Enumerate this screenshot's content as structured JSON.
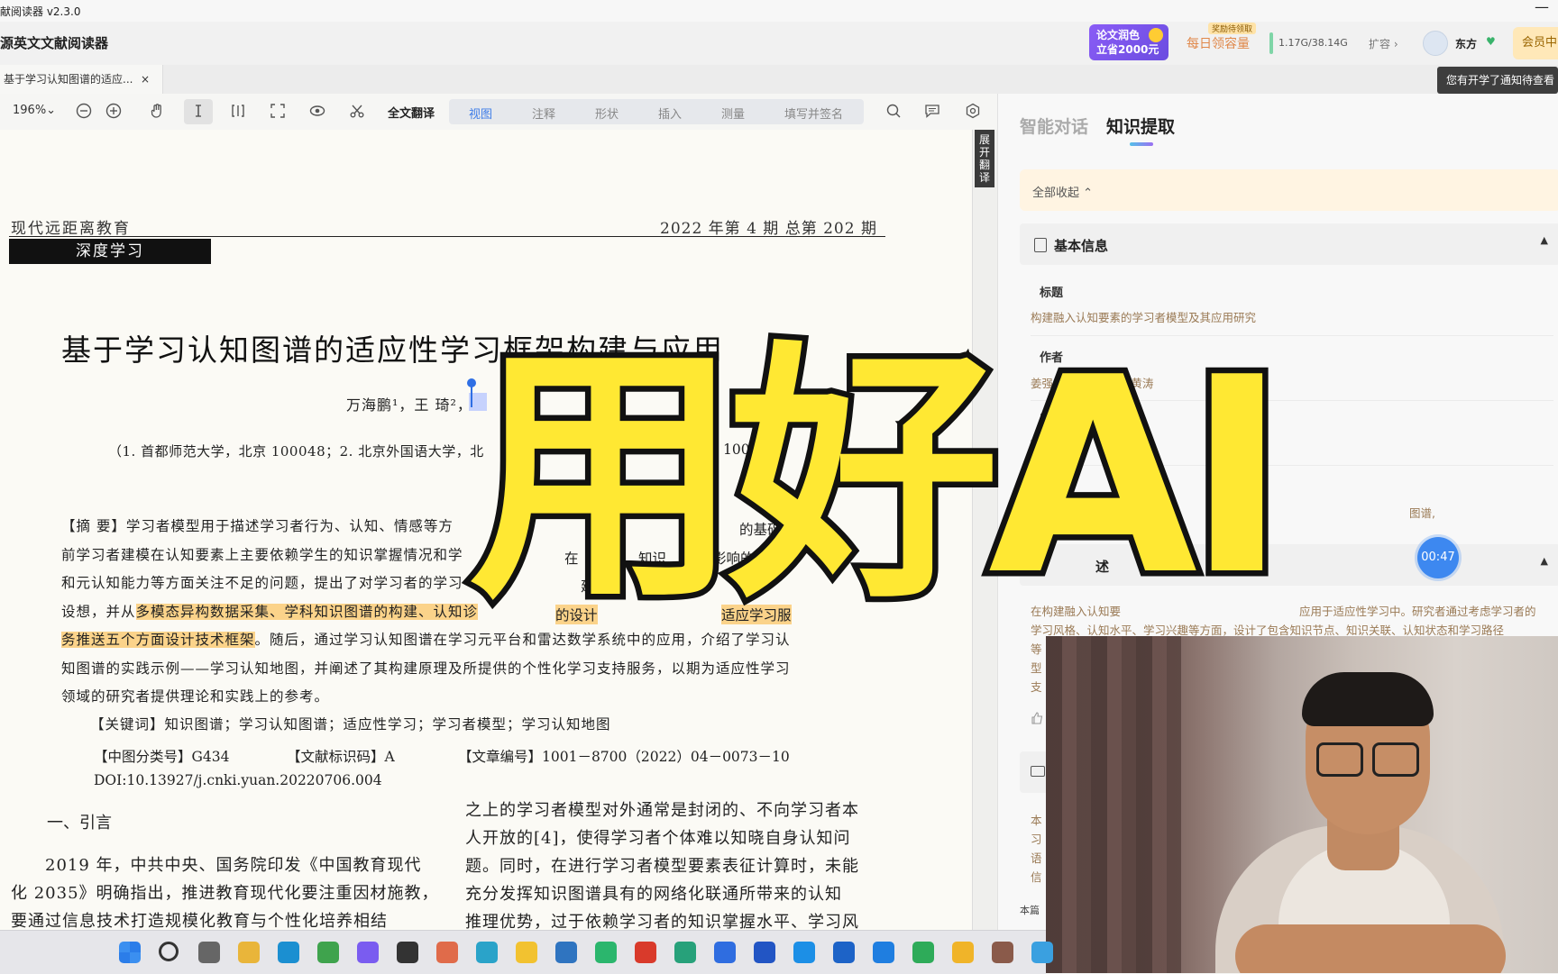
{
  "window": {
    "title": "献阅读器 v2.3.0",
    "minimize_glyph": "—"
  },
  "header": {
    "app_name": "源英文文献阅读器",
    "promo_line1": "论文润色",
    "promo_line2": "立省2000元",
    "daily_badge": "奖励待领取",
    "daily_label": "每日领容量",
    "storage": "1.17G/38.14G",
    "expand_label": "扩容 ›",
    "user_name": "东方",
    "user_vip": "♥",
    "member_label": "会员中"
  },
  "tabs": {
    "doc_tab_label": "基于学习认知图谱的适应...",
    "doc_tab_close": "×",
    "notify_text": "您有开学了通知待查看"
  },
  "toolbar": {
    "zoom": "196%⌄",
    "full_translate": "全文翻译",
    "tabs": [
      "视图",
      "注释",
      "形状",
      "插入",
      "测量",
      "填写并签名"
    ]
  },
  "document": {
    "journal_left": "现代远距离教育",
    "journal_right": "2022 年第 4 期   总第 202 期",
    "section_tag": "深度学习",
    "title": "基于学习认知图谱的适应性学习框架构建与应用",
    "authors": "万海鹏¹，王  琦²，",
    "affiliation": "（1. 首都师范大学，北京 100048；2. 北京外国语大学，北",
    "affiliation_tail": "100",
    "abstract_lines": [
      "【摘   要】学习者模型用于描述学习者行为、认知、情感等方",
      "前学习者建模在认知要素上主要依赖学生的知识掌握情况和学",
      "和元认知能力等方面关注不足的问题，提出了对学习者的学习",
      "设想，并从",
      "务推送五个方面设计技术框架",
      "知图谱的实践示例——学习认知地图，并阐述了其构建原理及所提供的个性化学习支持服务，以期为适应性学习",
      "领域的研究者提供理论和实践上的参考。"
    ],
    "abstract_right_fragments": [
      "的基础",
      "在",
      "知识",
      "影响的",
      "建模",
      "应用",
      "中",
      "适应学习服"
    ],
    "highlight_1": "多模态异构数据采集、学科知识图谱的构建、认知诊",
    "highlight_2": "的设计",
    "abstract_line5_rest": "。随后，通过学习认知图谱在学习元平台和雷达数学系统中的应用，介绍了学习认",
    "keywords": "【关键词】知识图谱；学习认知图谱；适应性学习；学习者模型；学习认知地图",
    "clc": "【中图分类号】G434",
    "doc_code": "【文献标识码】A",
    "article_no": "【文章编号】1001－8700（2022）04－0073－10",
    "doi": "DOI:10.13927/j.cnki.yuan.20220706.004",
    "intro_heading": "一、引言",
    "left_col": [
      "2019 年，中共中央、国务院印发《中国教育现代",
      "化 2035》明确指出，推进教育现代化要注重因材施教，",
      "要通过信息技术打造规模化教育与个性化培养相结"
    ],
    "right_col": [
      "之上的学习者模型对外通常是封闭的、不向学习者本",
      "人开放的[4]，使得学习者个体难以知晓自身认知问",
      "题。同时，在进行学习者模型要素表征计算时，未能",
      "充分发挥知识图谱具有的网络化联通所带来的认知",
      "推理优势，过于依赖学习者的知识掌握水平、学习风"
    ],
    "expand_translate": "展开翻译"
  },
  "panel": {
    "tab_chat": "智能对话",
    "tab_extract": "知识提取",
    "collapse_all": "全部收起 ⌃",
    "basic_info": "基本信息",
    "caret": "▲",
    "fields": [
      {
        "label": "标题",
        "value": "构建融入认知要素的学习者模型及其应用研究"
      },
      {
        "label": "作者",
        "value": "姜强, 李振, 刘凤娟, 黄涛"
      },
      {
        "label": "DOI",
        "value": "Text Not"
      },
      {
        "label": "关键",
        "value": "学习"
      }
    ],
    "keyword_tail": "图谱,",
    "summary_head": "述",
    "summary_lines": [
      "在构建融入认知要",
      "学习风格、认知水平、学习兴趣等方面，设计了包含知识节点、知识关联、认知状态和学习路径",
      "等",
      "型",
      "支"
    ],
    "summary_right": "应用于适应性学习中。研究者通过考虑学习者的",
    "lower_lines": [
      "本",
      "习",
      "语",
      "信"
    ],
    "footer": "本篇",
    "timer": "00:47"
  },
  "overlay": {
    "text": "用好AI"
  },
  "taskbar": {
    "icons": [
      "windows-start-icon",
      "search-icon",
      "task-view-icon",
      "file-explorer-icon",
      "edge-icon",
      "drive-icon",
      "copilot-icon",
      "terminal-icon",
      "paint-icon",
      "globe-icon",
      "sticky-notes-icon",
      "vscode-icon",
      "pycharm-icon",
      "wps-icon",
      "reader-app-icon",
      "mail-icon",
      "shield-icon",
      "diamond-app-icon",
      "bird-app-icon",
      "kite-app-icon",
      "screen-app-icon",
      "chrome-icon",
      "avatar-app-icon",
      "extra-app-icon"
    ]
  }
}
